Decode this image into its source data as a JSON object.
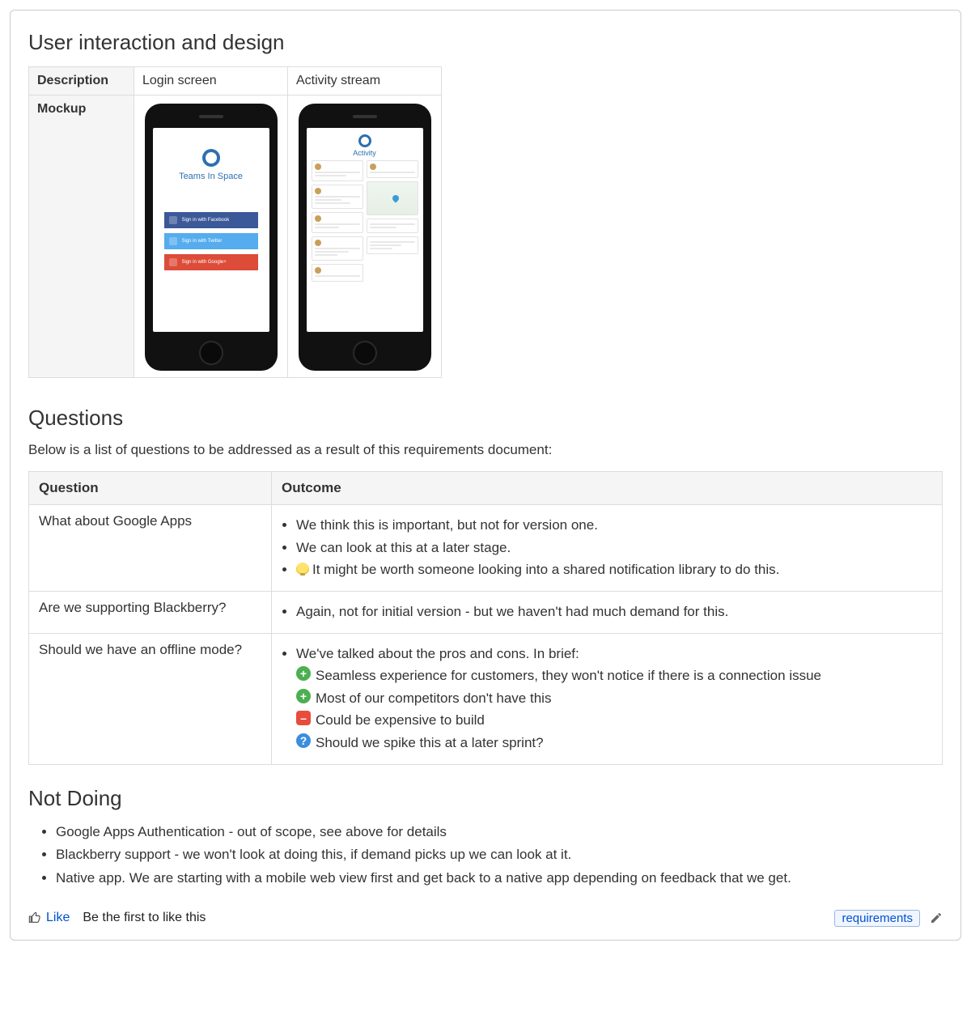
{
  "sections": {
    "ui": {
      "heading": "User interaction and design",
      "row_labels": {
        "description": "Description",
        "mockup": "Mockup"
      },
      "cols": [
        {
          "title": "Login screen",
          "mock": {
            "brand": "Teams In Space",
            "buttons": [
              "Sign in with Facebook",
              "Sign in with Twitter",
              "Sign in with Google+"
            ]
          }
        },
        {
          "title": "Activity stream",
          "mock": {
            "title": "Activity"
          }
        }
      ]
    },
    "questions": {
      "heading": "Questions",
      "lead": "Below is a list of questions to be addressed as a result of this requirements document:",
      "headers": {
        "q": "Question",
        "o": "Outcome"
      },
      "rows": [
        {
          "q": "What about Google Apps",
          "items": [
            {
              "text": "We think this is important, but not for version one."
            },
            {
              "text": "We can look at this at a later stage."
            },
            {
              "icon": "bulb",
              "text": "It might be worth someone looking into a shared notification library to do this."
            }
          ]
        },
        {
          "q": "Are we supporting Blackberry?",
          "items": [
            {
              "text": "Again, not for initial version - but we haven't had much demand for this."
            }
          ]
        },
        {
          "q": "Should we have an offline mode?",
          "items": [
            {
              "text": "We've talked about the pros and cons. In brief:",
              "sub": [
                {
                  "icon": "plus",
                  "text": "Seamless experience for customers, they won't notice if there is a connection issue"
                },
                {
                  "icon": "plus",
                  "text": "Most of our competitors don't have this"
                },
                {
                  "icon": "minus",
                  "text": "Could be expensive to build"
                },
                {
                  "icon": "qm",
                  "text": "Should we spike this at a later sprint?"
                }
              ]
            }
          ]
        }
      ]
    },
    "notdoing": {
      "heading": "Not Doing",
      "items": [
        "Google Apps Authentication - out of scope, see above for details",
        "Blackberry support - we won't look at doing this, if demand picks up we can look at it.",
        "Native app. We are starting with a mobile web view first and get back to a native app depending on feedback that we get."
      ]
    }
  },
  "footer": {
    "like": "Like",
    "hint": "Be the first to like this",
    "tag": "requirements"
  }
}
